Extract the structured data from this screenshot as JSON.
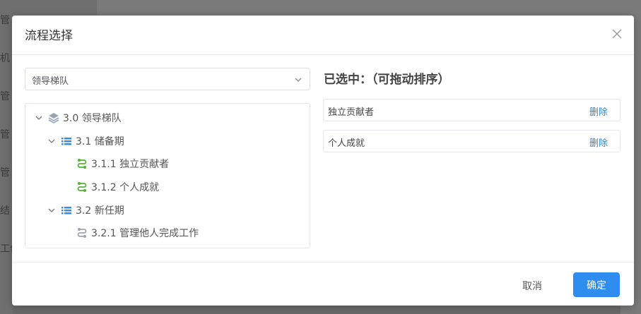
{
  "background": {
    "sidebar_items": [
      "管",
      "机",
      "管",
      "管",
      "管",
      "结",
      "工作",
      ""
    ]
  },
  "dialog": {
    "title": "流程选择",
    "close_icon": "close-icon",
    "select": {
      "value": "领导梯队"
    },
    "tree": {
      "root": "3.0 领导梯队",
      "groups": [
        {
          "label": "3.1 储备期",
          "children": [
            "3.1.1 独立贡献者",
            "3.1.2 个人成就"
          ]
        },
        {
          "label": "3.2 新任期",
          "children": [
            "3.2.1 管理他人完成工作"
          ]
        }
      ]
    },
    "selected": {
      "title": "已选中：（可拖动排序）",
      "items": [
        {
          "label": "独立贡献者",
          "delete": "删除"
        },
        {
          "label": "个人成就",
          "delete": "删除"
        }
      ]
    },
    "footer": {
      "cancel": "取消",
      "confirm": "确定"
    }
  },
  "colors": {
    "primary": "#2f8df0",
    "link": "#2f88d6",
    "active_process": "#52b233",
    "inactive_process": "#9aa4b5",
    "tree_group": "#2f8df0"
  }
}
